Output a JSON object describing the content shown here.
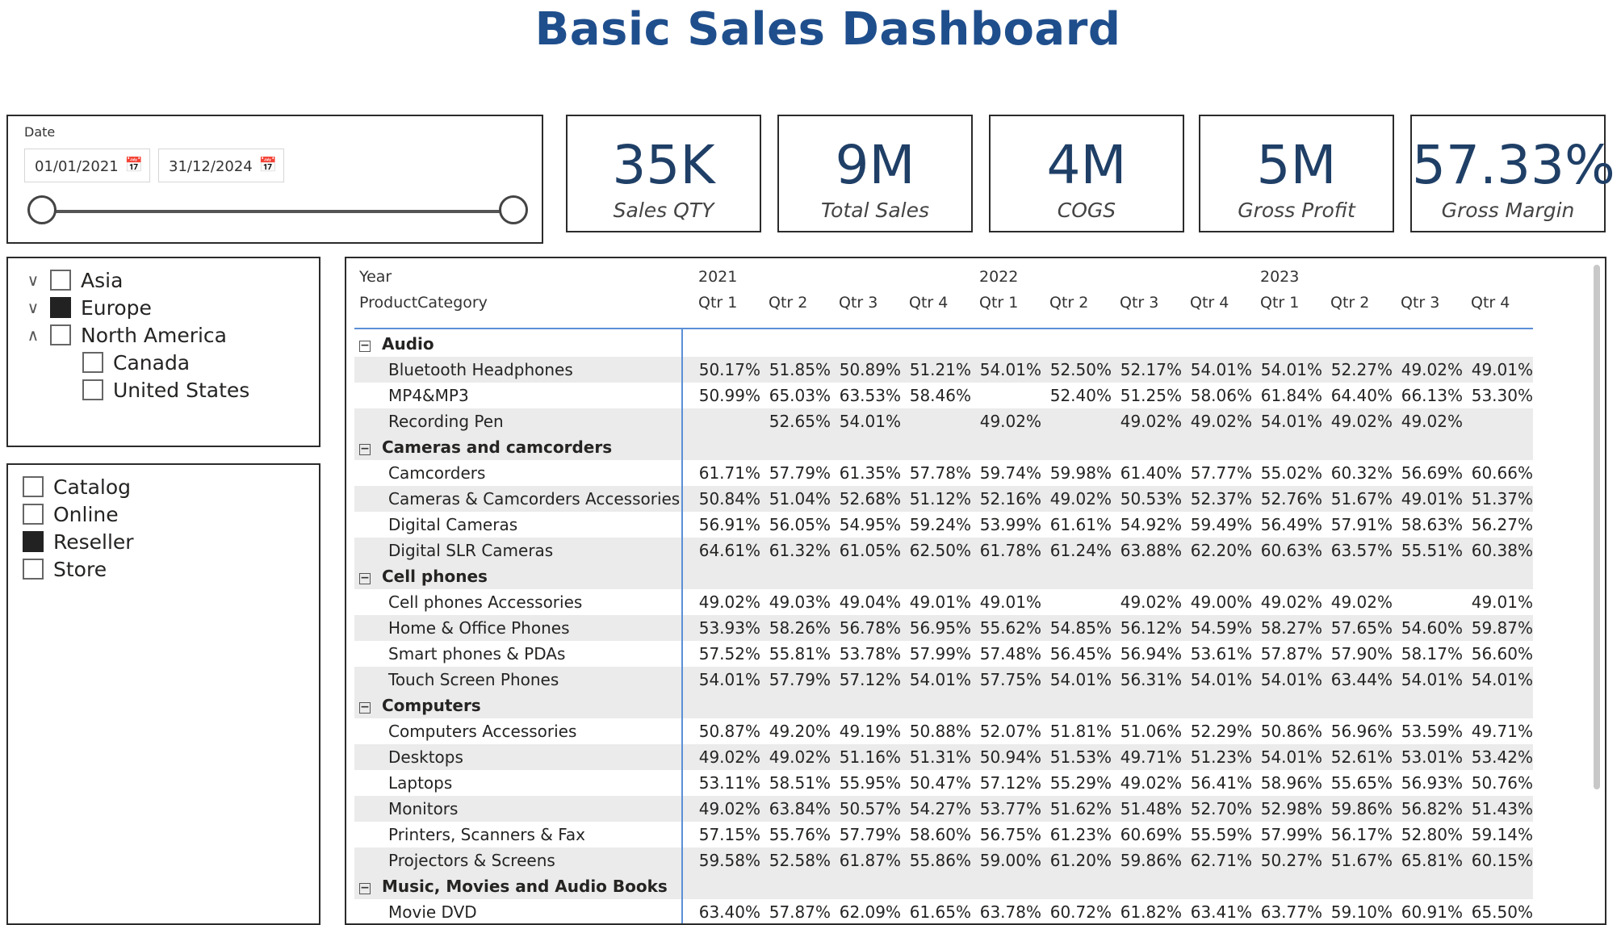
{
  "title": "Basic Sales Dashboard",
  "date_slicer": {
    "label": "Date",
    "start": "01/01/2021",
    "end": "31/12/2024",
    "calendar_icon": "calendar-icon"
  },
  "kpis": [
    {
      "value": "35K",
      "label": "Sales QTY"
    },
    {
      "value": "9M",
      "label": "Total Sales"
    },
    {
      "value": "4M",
      "label": "COGS"
    },
    {
      "value": "5M",
      "label": "Gross Profit"
    },
    {
      "value": "57.33%",
      "label": "Gross Margin"
    }
  ],
  "region_slicer": {
    "items": [
      {
        "label": "Asia",
        "chevron": "v",
        "checked": false
      },
      {
        "label": "Europe",
        "chevron": "v",
        "checked": true
      },
      {
        "label": "North America",
        "chevron": "^",
        "checked": false
      },
      {
        "label": "Canada",
        "checked": false
      },
      {
        "label": "United States",
        "checked": false
      }
    ]
  },
  "channel_slicer": {
    "items": [
      {
        "label": "Catalog",
        "checked": false
      },
      {
        "label": "Online",
        "checked": false
      },
      {
        "label": "Reseller",
        "checked": true
      },
      {
        "label": "Store",
        "checked": false
      }
    ]
  },
  "matrix": {
    "row_header_1": "Year",
    "row_header_2": "ProductCategory",
    "years": [
      "2021",
      "2022",
      "2023"
    ],
    "quarters": [
      "Qtr 1",
      "Qtr 2",
      "Qtr 3",
      "Qtr 4",
      "Qtr 1",
      "Qtr 2",
      "Qtr 3",
      "Qtr 4",
      "Qtr 1",
      "Qtr 2",
      "Qtr 3",
      "Qtr 4"
    ],
    "expander_symbol": "−",
    "rows": [
      {
        "type": "category",
        "label": "Audio"
      },
      {
        "type": "item",
        "label": "Bluetooth Headphones",
        "values": [
          "50.17%",
          "51.85%",
          "50.89%",
          "51.21%",
          "54.01%",
          "52.50%",
          "52.17%",
          "54.01%",
          "54.01%",
          "52.27%",
          "49.02%",
          "49.01%"
        ]
      },
      {
        "type": "item",
        "label": "MP4&MP3",
        "values": [
          "50.99%",
          "65.03%",
          "63.53%",
          "58.46%",
          "",
          "52.40%",
          "51.25%",
          "58.06%",
          "61.84%",
          "64.40%",
          "66.13%",
          "53.30%"
        ]
      },
      {
        "type": "item",
        "label": "Recording Pen",
        "values": [
          "",
          "52.65%",
          "54.01%",
          "",
          "49.02%",
          "",
          "49.02%",
          "49.02%",
          "54.01%",
          "49.02%",
          "49.02%",
          ""
        ]
      },
      {
        "type": "category",
        "label": "Cameras and camcorders"
      },
      {
        "type": "item",
        "label": "Camcorders",
        "values": [
          "61.71%",
          "57.79%",
          "61.35%",
          "57.78%",
          "59.74%",
          "59.98%",
          "61.40%",
          "57.77%",
          "55.02%",
          "60.32%",
          "56.69%",
          "60.66%"
        ]
      },
      {
        "type": "item",
        "label": "Cameras & Camcorders Accessories",
        "values": [
          "50.84%",
          "51.04%",
          "52.68%",
          "51.12%",
          "52.16%",
          "49.02%",
          "50.53%",
          "52.37%",
          "52.76%",
          "51.67%",
          "49.01%",
          "51.37%"
        ]
      },
      {
        "type": "item",
        "label": "Digital Cameras",
        "values": [
          "56.91%",
          "56.05%",
          "54.95%",
          "59.24%",
          "53.99%",
          "61.61%",
          "54.92%",
          "59.49%",
          "56.49%",
          "57.91%",
          "58.63%",
          "56.27%"
        ]
      },
      {
        "type": "item",
        "label": "Digital SLR Cameras",
        "values": [
          "64.61%",
          "61.32%",
          "61.05%",
          "62.50%",
          "61.78%",
          "61.24%",
          "63.88%",
          "62.20%",
          "60.63%",
          "63.57%",
          "55.51%",
          "60.38%"
        ]
      },
      {
        "type": "category",
        "label": "Cell phones"
      },
      {
        "type": "item",
        "label": "Cell phones Accessories",
        "values": [
          "49.02%",
          "49.03%",
          "49.04%",
          "49.01%",
          "49.01%",
          "",
          "49.02%",
          "49.00%",
          "49.02%",
          "49.02%",
          "",
          "49.01%"
        ]
      },
      {
        "type": "item",
        "label": "Home & Office Phones",
        "values": [
          "53.93%",
          "58.26%",
          "56.78%",
          "56.95%",
          "55.62%",
          "54.85%",
          "56.12%",
          "54.59%",
          "58.27%",
          "57.65%",
          "54.60%",
          "59.87%"
        ]
      },
      {
        "type": "item",
        "label": "Smart phones & PDAs",
        "values": [
          "57.52%",
          "55.81%",
          "53.78%",
          "57.99%",
          "57.48%",
          "56.45%",
          "56.94%",
          "53.61%",
          "57.87%",
          "57.90%",
          "58.17%",
          "56.60%"
        ]
      },
      {
        "type": "item",
        "label": "Touch Screen Phones",
        "values": [
          "54.01%",
          "57.79%",
          "57.12%",
          "54.01%",
          "57.75%",
          "54.01%",
          "56.31%",
          "54.01%",
          "54.01%",
          "63.44%",
          "54.01%",
          "54.01%"
        ]
      },
      {
        "type": "category",
        "label": "Computers"
      },
      {
        "type": "item",
        "label": "Computers Accessories",
        "values": [
          "50.87%",
          "49.20%",
          "49.19%",
          "50.88%",
          "52.07%",
          "51.81%",
          "51.06%",
          "52.29%",
          "50.86%",
          "56.96%",
          "53.59%",
          "49.71%"
        ]
      },
      {
        "type": "item",
        "label": "Desktops",
        "values": [
          "49.02%",
          "49.02%",
          "51.16%",
          "51.31%",
          "50.94%",
          "51.53%",
          "49.71%",
          "51.23%",
          "54.01%",
          "52.61%",
          "53.01%",
          "53.42%"
        ]
      },
      {
        "type": "item",
        "label": "Laptops",
        "values": [
          "53.11%",
          "58.51%",
          "55.95%",
          "50.47%",
          "57.12%",
          "55.29%",
          "49.02%",
          "56.41%",
          "58.96%",
          "55.65%",
          "56.93%",
          "50.76%"
        ]
      },
      {
        "type": "item",
        "label": "Monitors",
        "values": [
          "49.02%",
          "63.84%",
          "50.57%",
          "54.27%",
          "53.77%",
          "51.62%",
          "51.48%",
          "52.70%",
          "52.98%",
          "59.86%",
          "56.82%",
          "51.43%"
        ]
      },
      {
        "type": "item",
        "label": "Printers, Scanners & Fax",
        "values": [
          "57.15%",
          "55.76%",
          "57.79%",
          "58.60%",
          "56.75%",
          "61.23%",
          "60.69%",
          "55.59%",
          "57.99%",
          "56.17%",
          "52.80%",
          "59.14%"
        ]
      },
      {
        "type": "item",
        "label": "Projectors & Screens",
        "values": [
          "59.58%",
          "52.58%",
          "61.87%",
          "55.86%",
          "59.00%",
          "61.20%",
          "59.86%",
          "62.71%",
          "50.27%",
          "51.67%",
          "65.81%",
          "60.15%"
        ]
      },
      {
        "type": "category",
        "label": "Music, Movies and Audio Books"
      },
      {
        "type": "item",
        "label": "Movie DVD",
        "values": [
          "63.40%",
          "57.87%",
          "62.09%",
          "61.65%",
          "63.78%",
          "60.72%",
          "61.82%",
          "63.41%",
          "63.77%",
          "59.10%",
          "60.91%",
          "65.50%"
        ]
      }
    ]
  },
  "colors": {
    "title": "#1f4e8c",
    "kpi_value": "#1f3f66",
    "accent_line": "#5b8fd6",
    "row_shade": "#ebebeb"
  }
}
